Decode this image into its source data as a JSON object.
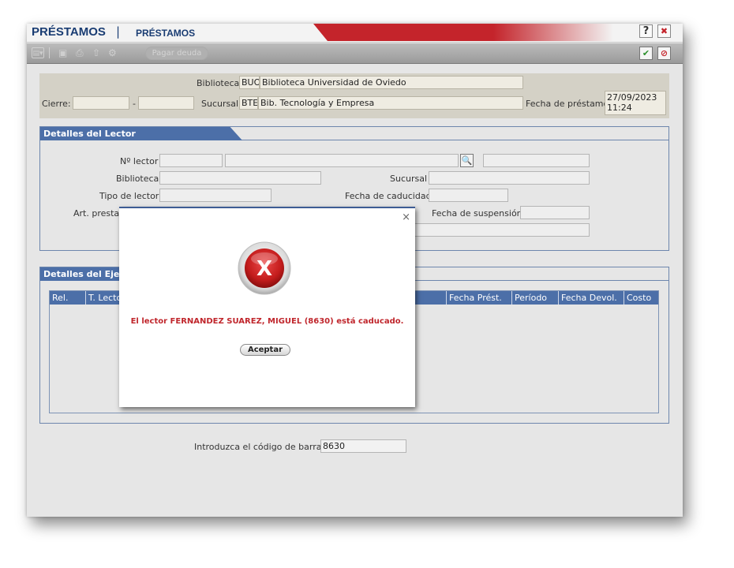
{
  "window": {
    "title": "PRÉSTAMOS",
    "separator": "|",
    "subtitle": "PRÉSTAMOS",
    "help_label": "?",
    "close_label": "✖"
  },
  "toolbar": {
    "pagar_label": "Pagar deuda"
  },
  "header": {
    "biblioteca_label": "Biblioteca",
    "biblioteca_code": "BUO",
    "biblioteca_name": "Biblioteca Universidad de Oviedo",
    "cierre_label": "Cierre:",
    "cierre_from": "",
    "cierre_dash": "-",
    "cierre_to": "",
    "sucursal_label": "Sucursal",
    "sucursal_code": "BTE",
    "sucursal_name": "Bib. Tecnología y Empresa",
    "fecha_label": "Fecha de préstamo",
    "fecha_date": "27/09/2023",
    "fecha_time": "11:24"
  },
  "lector": {
    "section_title": "Detalles del Lector",
    "num_lector_label": "Nº lector",
    "num_lector_value": "",
    "nombre_value": "",
    "extra_value": "",
    "biblioteca_label": "Biblioteca",
    "biblioteca_value": "",
    "sucursal_label": "Sucursal",
    "sucursal_value": "",
    "tipo_label": "Tipo de lector",
    "tipo_value": "",
    "caducidad_label": "Fecha de caducidad",
    "caducidad_value": "",
    "art_label": "Art. presta",
    "suspension_label": "Fecha de suspensión",
    "suspension_value": ""
  },
  "ejemplar": {
    "section_title": "Detalles del Ejem",
    "columns": [
      "Rel.",
      "T. Lector",
      "Fecha Prést.",
      "Período",
      "Fecha Devol.",
      "Costo"
    ]
  },
  "barcode": {
    "label": "Introduzca el código de barras",
    "value": "8630"
  },
  "modal": {
    "close_label": "×",
    "icon_label": "X",
    "message": "El lector FERNANDEZ SUAREZ, MIGUEL (8630) está caducado.",
    "accept_label": "Aceptar"
  },
  "colors": {
    "brand_blue": "#1a3d73",
    "section_blue": "#4c6fa8",
    "error_red": "#c0262c"
  }
}
